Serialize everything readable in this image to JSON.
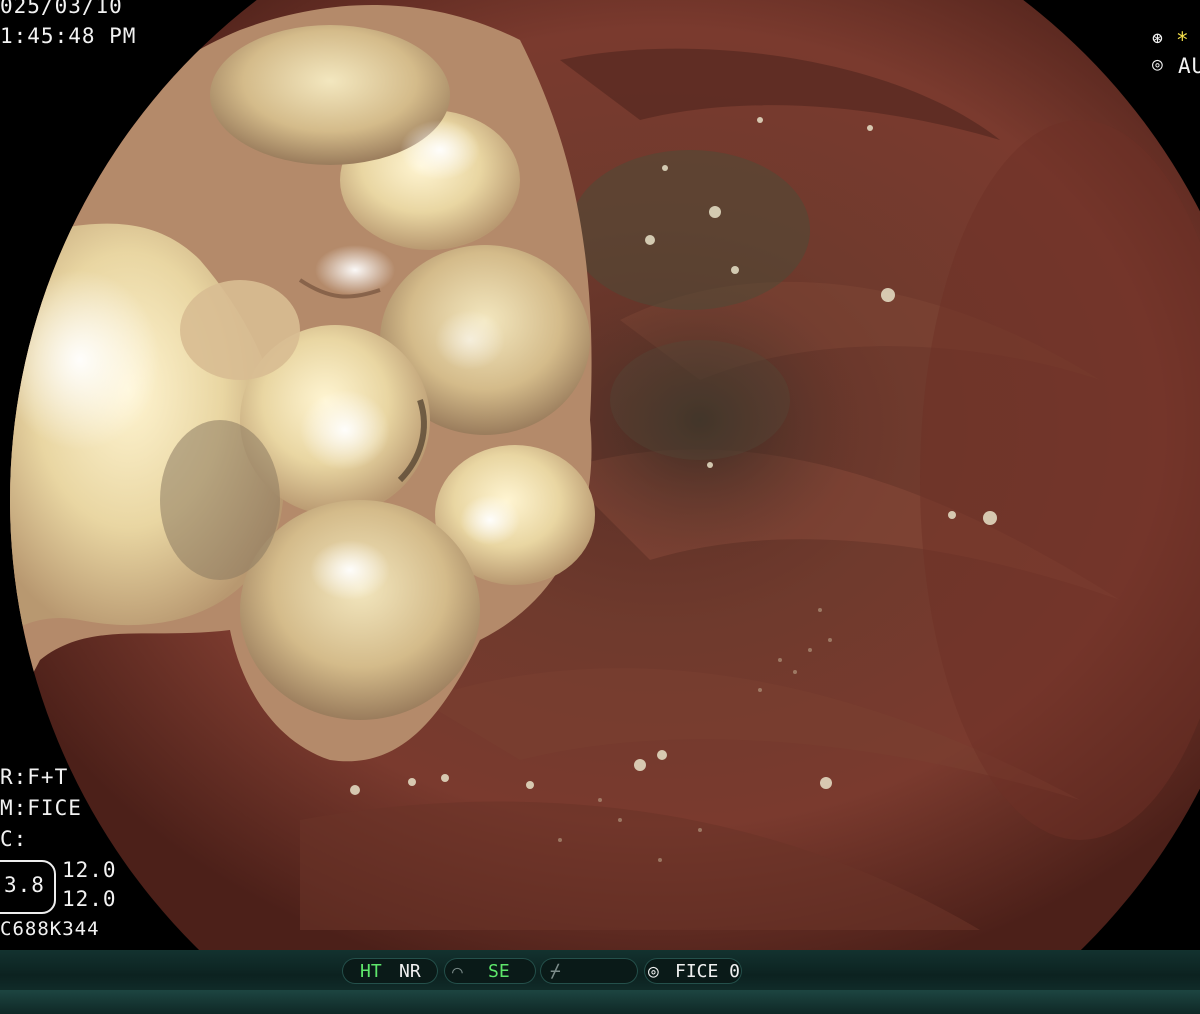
{
  "osd": {
    "date": "025/03/10",
    "time": "1:45:48  PM",
    "top_right_star": "*",
    "top_right_mode": "AU",
    "structure": "R:F+T",
    "mode": "M:FICE",
    "c_label": "C:",
    "zoom_value": "3.8",
    "param_top": "12.0",
    "param_bottom": "12.0",
    "scope_id": "C688K344"
  },
  "status_bar": {
    "ht": "HT",
    "nr": "NR",
    "se": "SE",
    "fice": "FICE 0"
  },
  "colors": {
    "tissue": "#6d3328",
    "lesion": "#e9d6a2",
    "status_green": "#5ee66b"
  }
}
